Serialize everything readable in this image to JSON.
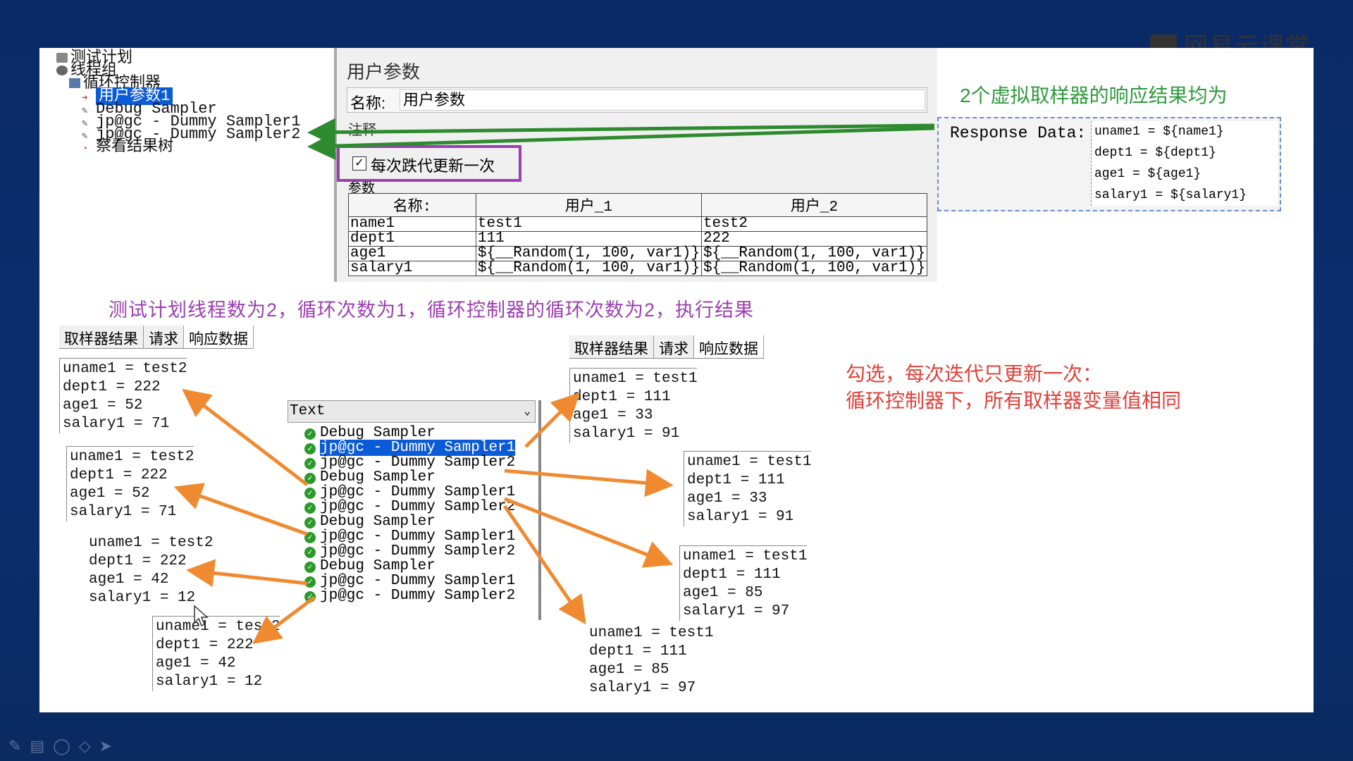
{
  "logo": {
    "text": "网易云课堂"
  },
  "tree": {
    "items": [
      "测试计划",
      "线程组",
      "循环控制器",
      "用户参数1",
      "Debug Sampler",
      "jp@gc - Dummy Sampler1",
      "jp@gc - Dummy Sampler2",
      "察看结果树"
    ]
  },
  "panel": {
    "title": "用户参数",
    "name_label": "名称:",
    "name_value": "用户参数",
    "comment_label": "注释",
    "checkbox_label": "每次跌代更新一次",
    "params_label": "参数",
    "columns": [
      "名称:",
      "用户_1",
      "用户_2"
    ],
    "rows": [
      [
        "name1",
        "test1",
        "test2"
      ],
      [
        "dept1",
        "111",
        "222"
      ],
      [
        "age1",
        "${__Random(1, 100, var1)}",
        "${__Random(1, 100, var1)}"
      ],
      [
        "salary1",
        "${__Random(1, 100, var1)}",
        "${__Random(1, 100, var1)}"
      ]
    ]
  },
  "note_green": "2个虚拟取样器的响应结果均为",
  "response_box": {
    "header": "Response Data:",
    "lines": [
      "uname1 = ${name1}",
      "dept1 = ${dept1}",
      "age1 = ${age1}",
      "salary1 = ${salary1}"
    ]
  },
  "note_purple": "测试计划线程数为2，循环次数为1，循环控制器的循环次数为2，执行结果",
  "note_red": [
    "勾选，每次迭代只更新一次：",
    "循环控制器下，所有取样器变量值相同"
  ],
  "tabs": [
    "取样器结果",
    "请求",
    "响应数据"
  ],
  "result_list": {
    "renderer": "Text",
    "items": [
      "Debug Sampler",
      "jp@gc - Dummy Sampler1",
      "jp@gc - Dummy Sampler2",
      "Debug Sampler",
      "jp@gc - Dummy Sampler1",
      "jp@gc - Dummy Sampler2",
      "Debug Sampler",
      "jp@gc - Dummy Sampler1",
      "jp@gc - Dummy Sampler2",
      "Debug Sampler",
      "jp@gc - Dummy Sampler1",
      "jp@gc - Dummy Sampler2"
    ]
  },
  "left_results": [
    [
      "uname1 = test2",
      "dept1 = 222",
      "age1 = 52",
      "salary1 = 71"
    ],
    [
      "uname1 = test2",
      "dept1 = 222",
      "age1 = 52",
      "salary1 = 71"
    ],
    [
      "uname1 = test2",
      "dept1 = 222",
      "age1 = 42",
      "salary1 = 12"
    ],
    [
      "uname1 = test2",
      "dept1 = 222",
      "age1 = 42",
      "salary1 = 12"
    ]
  ],
  "right_results": [
    [
      "uname1 = test1",
      "dept1 = 111",
      "age1 = 33",
      "salary1 = 91"
    ],
    [
      "uname1 = test1",
      "dept1 = 111",
      "age1 = 33",
      "salary1 = 91"
    ],
    [
      "uname1 = test1",
      "dept1 = 111",
      "age1 = 85",
      "salary1 = 97"
    ],
    [
      "uname1 = test1",
      "dept1 = 111",
      "age1 = 85",
      "salary1 = 97"
    ]
  ],
  "colors": {
    "arrow_orange": "#f08a30",
    "arrow_green": "#2e8a2e",
    "purple": "#9b3fb0",
    "red": "#e0403a",
    "selection": "#0b5bd8"
  }
}
